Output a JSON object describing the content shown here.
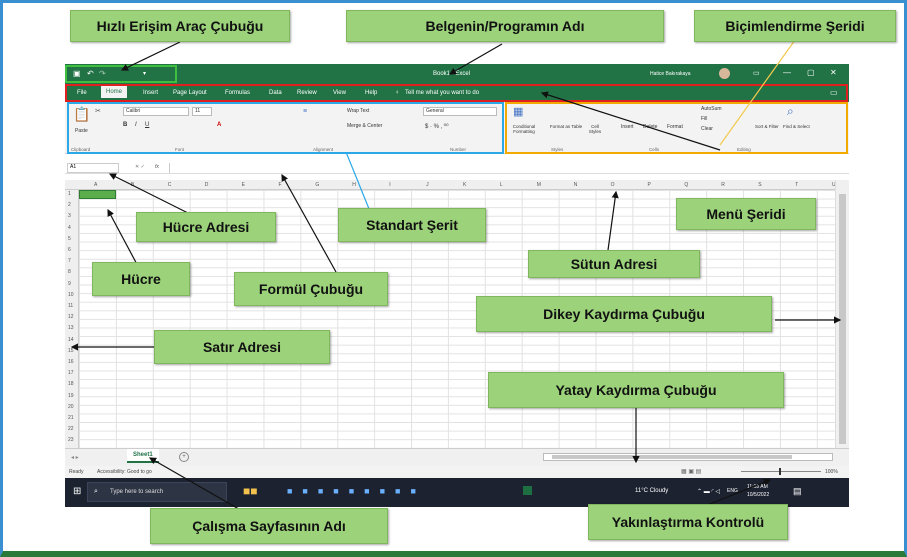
{
  "excel": {
    "title": "Book1 - Excel",
    "qat_undo": "↶",
    "qat_redo": "↷",
    "user": "Hatice Bakırakaya",
    "menu": [
      "File",
      "Home",
      "Insert",
      "Page Layout",
      "Formulas",
      "Data",
      "Review",
      "View",
      "Help"
    ],
    "tell_me": "Tell me what you want to do",
    "ribbon": {
      "paste": "Paste",
      "clipboard": "Clipboard",
      "font_name": "Calibri",
      "font_size": "11",
      "font_group": "Font",
      "wrap_text": "Wrap Text",
      "merge_center": "Merge & Center",
      "alignment_group": "Alignment",
      "number_format": "General",
      "number_group": "Number",
      "conditional_formatting": "Conditional Formatting",
      "format_as_table": "Format as Table",
      "cell_styles": "Cell Styles",
      "styles_group": "Styles",
      "insert": "Insert",
      "delete": "Delete",
      "format": "Format",
      "cells_group": "Cells",
      "autosum": "AutoSum",
      "fill": "Fill",
      "clear": "Clear",
      "sort_filter": "Sort & Filter",
      "find_select": "Find & Select",
      "editing_group": "Editing"
    },
    "name_box": "A1",
    "fx": "fx",
    "columns": [
      "A",
      "B",
      "C",
      "D",
      "E",
      "F",
      "G",
      "H",
      "I",
      "J",
      "K",
      "L",
      "M",
      "N",
      "O",
      "P",
      "Q",
      "R",
      "S",
      "T",
      "U"
    ],
    "rows": [
      "1",
      "2",
      "3",
      "4",
      "5",
      "6",
      "7",
      "8",
      "9",
      "10",
      "11",
      "12",
      "13",
      "14",
      "15",
      "16",
      "17",
      "18",
      "19",
      "20",
      "21",
      "22",
      "23"
    ],
    "sheet_tab": "Sheet1",
    "add_sheet": "+",
    "status_ready": "Ready",
    "accessibility": "Accessibility: Good to go",
    "zoom": "100%",
    "taskbar": {
      "search": "Type here to search",
      "weather": "11°C  Cloudy",
      "lang": "ENG",
      "time": "11:18 AM",
      "date": "10/5/2022"
    }
  },
  "callouts": {
    "quick_access": "Hızlı Erişim Araç Çubuğu",
    "doc_name": "Belgenin/Programın Adı",
    "format_ribbon": "Biçimlendirme Şeridi",
    "cell_address": "Hücre Adresi",
    "standard_ribbon": "Standart Şerit",
    "menu_ribbon": "Menü Şeridi",
    "cell": "Hücre",
    "column_address": "Sütun Adresi",
    "formula_bar": "Formül Çubuğu",
    "vertical_scroll": "Dikey Kaydırma Çubuğu",
    "row_address": "Satır Adresi",
    "horizontal_scroll": "Yatay Kaydırma Çubuğu",
    "sheet_name": "Çalışma Sayfasının Adı",
    "zoom_control": "Yakınlaştırma Kontrolü"
  },
  "colors": {
    "excel_green": "#217346",
    "callout_green": "#9bd27a",
    "red_box": "#e02020",
    "blue_box": "#2aa8e8",
    "orange_box": "#f2a900"
  }
}
